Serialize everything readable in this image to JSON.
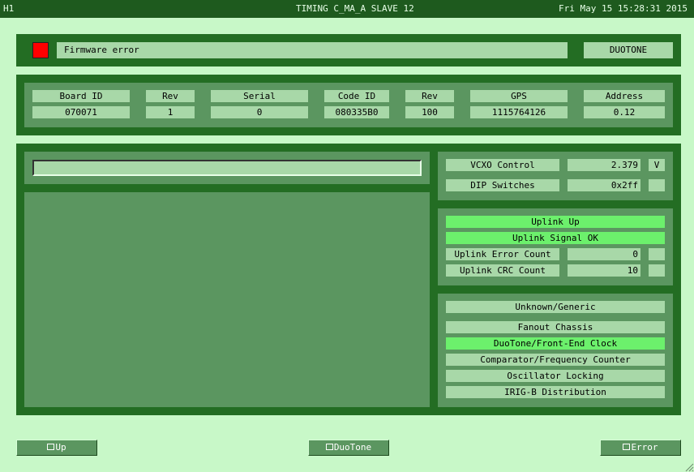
{
  "titlebar": {
    "left": "H1",
    "title": "TIMING C_MA_A SLAVE 12",
    "datetime": "Fri May 15 15:28:31 2015"
  },
  "status": {
    "indicator_color": "#ff0000",
    "message": "Firmware error",
    "mode": "DUOTONE"
  },
  "info": {
    "board_id": {
      "label": "Board ID",
      "value": "070071"
    },
    "rev1": {
      "label": "Rev",
      "value": "1"
    },
    "serial": {
      "label": "Serial",
      "value": "0"
    },
    "code_id": {
      "label": "Code ID",
      "value": "080335B0"
    },
    "rev2": {
      "label": "Rev",
      "value": "100"
    },
    "gps": {
      "label": "GPS",
      "value": "1115764126"
    },
    "address": {
      "label": "Address",
      "value": "0.12"
    }
  },
  "input": {
    "value": ""
  },
  "vcxo": {
    "label": "VCXO Control",
    "value": "2.379",
    "unit": "V"
  },
  "dip": {
    "label": "DIP Switches",
    "value": "0x2ff",
    "unit": ""
  },
  "uplink": {
    "up": "Uplink Up",
    "signal_ok": "Uplink Signal OK",
    "error_count": {
      "label": "Uplink Error Count",
      "value": "0"
    },
    "crc_count": {
      "label": "Uplink CRC Count",
      "value": "10"
    }
  },
  "types": {
    "unknown": "Unknown/Generic",
    "items": [
      "Fanout Chassis",
      "DuoTone/Front-End Clock",
      "Comparator/Frequency Counter",
      "Oscillator Locking",
      "IRIG-B Distribution"
    ],
    "active_index": 1
  },
  "buttons": {
    "up": "Up",
    "duotone": "DuoTone",
    "error": "Error"
  },
  "colors": {
    "background": "#c8f8c8",
    "panel": "#236d23",
    "inner": "#5b9660",
    "label": "#a8d8a8",
    "active": "#6cf06c"
  }
}
